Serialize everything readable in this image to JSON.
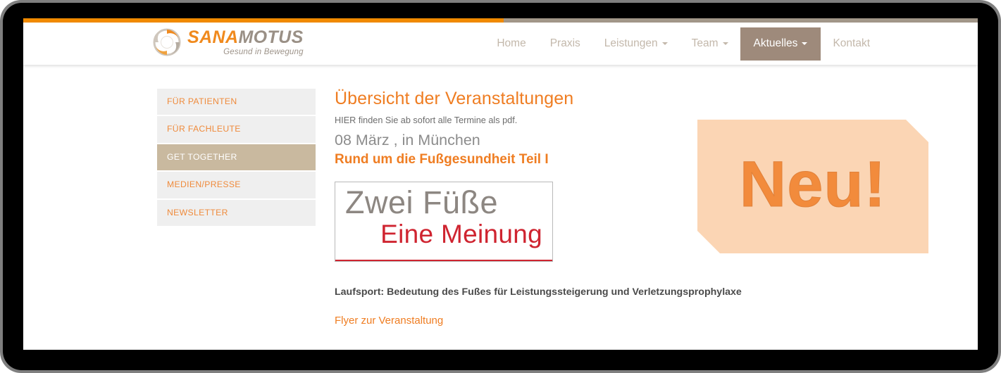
{
  "brand": {
    "word_part1": "SANA",
    "word_part2": "MOTUS",
    "tagline": "Gesund in Bewegung",
    "logo_icon": "swirl-logo-icon",
    "color_orange": "#f08a1e",
    "color_gray": "#9a9086"
  },
  "nav": {
    "items": [
      {
        "label": "Home",
        "has_dropdown": false,
        "active": false
      },
      {
        "label": "Praxis",
        "has_dropdown": false,
        "active": false
      },
      {
        "label": "Leistungen",
        "has_dropdown": true,
        "active": false
      },
      {
        "label": "Team",
        "has_dropdown": true,
        "active": false
      },
      {
        "label": "Aktuelles",
        "has_dropdown": true,
        "active": true
      },
      {
        "label": "Kontakt",
        "has_dropdown": false,
        "active": false
      }
    ],
    "active_bg": "#9e8a7b",
    "inactive_color": "#c3b8ab"
  },
  "topbar": {
    "fill_color": "#f18a00",
    "track_color": "#a29789",
    "fill_percent": "50.3%"
  },
  "sidebar": {
    "items": [
      {
        "label": "FÜR PATIENTEN",
        "active": false
      },
      {
        "label": "FÜR FACHLEUTE",
        "active": false
      },
      {
        "label": "GET TOGETHER",
        "active": true
      },
      {
        "label": "MEDIEN/PRESSE",
        "active": false
      },
      {
        "label": "NEWSLETTER",
        "active": false
      }
    ],
    "item_bg": "#efefef",
    "item_color": "#ef8b3c",
    "active_bg": "#c9b99f"
  },
  "main": {
    "page_title": "Übersicht der Veranstaltungen",
    "subnote": "HIER finden Sie ab sofort alle Termine als pdf.",
    "event_date": "08 März , in München",
    "event_title": "Rund um die Fußgesundheit Teil I",
    "event_image": {
      "line1": "Zwei Füße",
      "line2": "Eine Meinung",
      "line1_color": "#8d8782",
      "line2_color": "#cf2430"
    },
    "lead_bold": "Laufsport: Bedeutung des Fußes für Leistungssteigerung und Verletzungsprophylaxe",
    "flyer_link": "Flyer zur Veranstaltung"
  },
  "banner": {
    "text": "Neu!",
    "bg_color": "#fbd5b4",
    "text_color": "#f28b3c"
  }
}
